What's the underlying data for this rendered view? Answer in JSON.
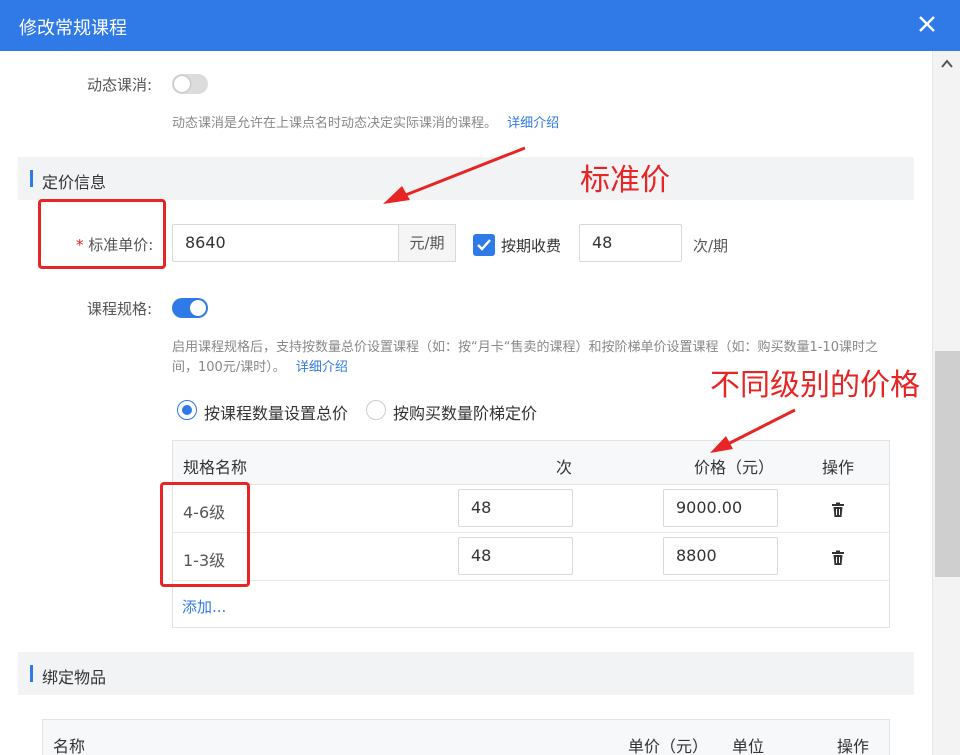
{
  "dialog": {
    "title": "修改常规课程"
  },
  "dynamic_cancel": {
    "label": "动态课消:",
    "enabled": false,
    "hint": "动态课消是允许在上课点名时动态决定实际课消的课程。",
    "hint_link": "详细介绍"
  },
  "pricing_section": {
    "title": "定价信息"
  },
  "standard_price": {
    "required_mark": "*",
    "label": "标准单价:",
    "value": "8640",
    "unit": "元/期",
    "by_period_label": "按期收费",
    "by_period_checked": true,
    "count_value": "48",
    "count_unit": "次/期"
  },
  "spec": {
    "label": "课程规格:",
    "enabled": true,
    "hint": "启用课程规格后，支持按数量总价设置课程（如：按“月卡“售卖的课程）和按阶梯单价设置课程（如：购买数量1-10课时之间，100元/课时）。",
    "hint_link": "详细介绍",
    "radio_total": "按课程数量设置总价",
    "radio_tier": "按购买数量阶梯定价",
    "selected": "total"
  },
  "spec_table": {
    "headers": [
      "规格名称",
      "次",
      "价格（元）",
      "操作"
    ],
    "rows": [
      {
        "name": "4-6级",
        "count": "48",
        "price": "9000.00"
      },
      {
        "name": "1-3级",
        "count": "48",
        "price": "8800"
      }
    ],
    "add_label": "添加..."
  },
  "bind_section": {
    "title": "绑定物品"
  },
  "bind_table": {
    "headers": [
      "名称",
      "单价（元）",
      "单位",
      "操作"
    ]
  },
  "annotations": {
    "standard_price_note": "标准价",
    "tier_price_note": "不同级别的价格"
  },
  "colors": {
    "accent": "#2f7ae6",
    "annotation": "#e82424",
    "section_bg": "#f2f3f5"
  }
}
